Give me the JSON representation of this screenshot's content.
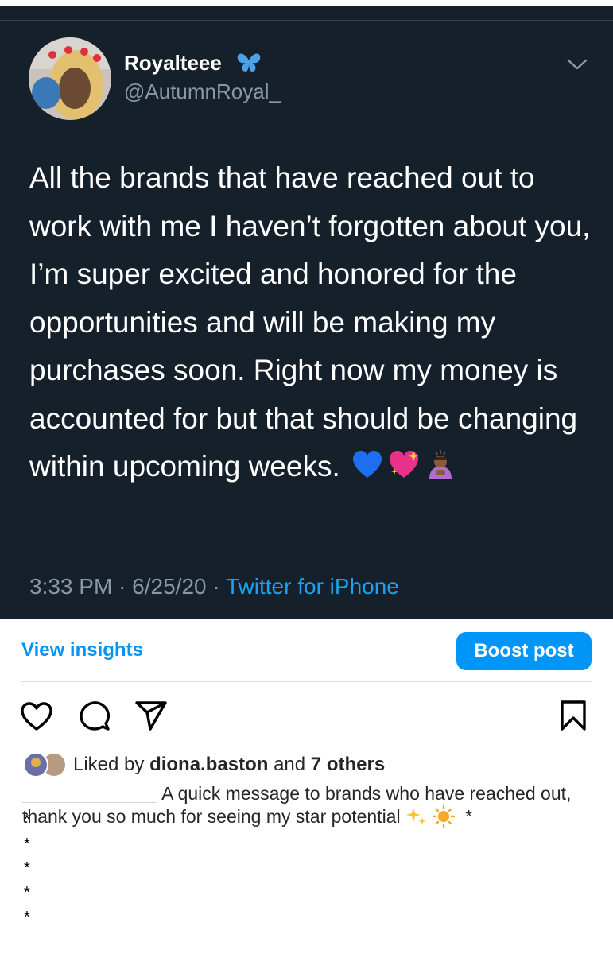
{
  "tweet": {
    "display_name": "Royalteee",
    "handle": "@AutumnRoyal_",
    "text": "All the brands that have reached out to work with me I haven’t forgotten about you, I’m super excited and honored for the opportunities and will be making my purchases soon. Right now my money is accounted for but that should be changing within upcoming weeks.",
    "emojis": [
      "blue-heart-emoji",
      "sparkling-heart-emoji",
      "bowing-person-emoji"
    ],
    "time": "3:33 PM",
    "date": "6/25/20",
    "separator": "·",
    "source": "Twitter for iPhone",
    "colors": {
      "background": "#15202b",
      "text": "#ffffff",
      "secondary": "#8899a6",
      "link": "#1da1f2"
    }
  },
  "post": {
    "view_insights_label": "View insights",
    "boost_label": "Boost post",
    "likes": {
      "prefix": "Liked by",
      "user": "diona.baston",
      "joiner": "and",
      "others": "7 others"
    },
    "caption": {
      "text_line": "A quick message to brands who have reached out, thank you so much for seeing my star potential",
      "trailing": "*",
      "star_lines": [
        "*",
        "*",
        "*",
        "*",
        "*"
      ]
    },
    "icons": [
      "heart-icon",
      "comment-icon",
      "share-icon",
      "bookmark-icon"
    ],
    "colors": {
      "accent": "#0095f6",
      "text": "#262626"
    }
  }
}
